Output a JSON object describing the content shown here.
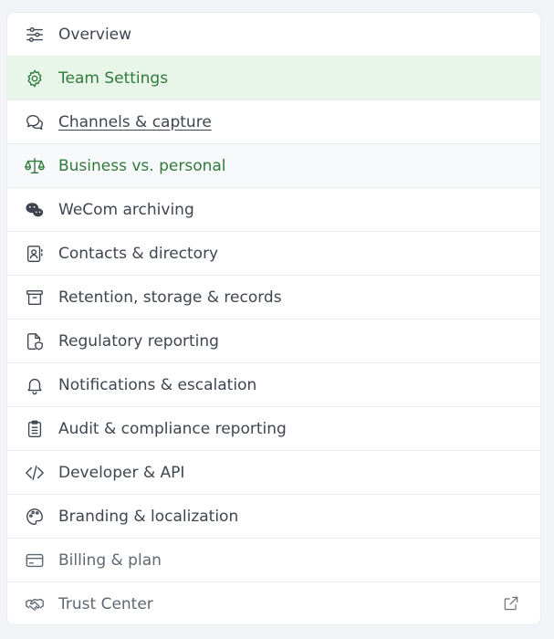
{
  "nav": {
    "items": [
      {
        "label": "Overview",
        "icon": "sliders-icon",
        "state": "normal"
      },
      {
        "label": "Team Settings",
        "icon": "gear-icon",
        "state": "active"
      },
      {
        "label": "Channels & capture",
        "icon": "chat-bubbles-icon",
        "state": "underlined"
      },
      {
        "label": "Business vs. personal",
        "icon": "scale-icon",
        "state": "hovered"
      },
      {
        "label": "WeCom archiving",
        "icon": "wechat-icon",
        "state": "normal"
      },
      {
        "label": "Contacts & directory",
        "icon": "contact-book-icon",
        "state": "normal"
      },
      {
        "label": "Retention, storage & records",
        "icon": "archive-box-icon",
        "state": "normal"
      },
      {
        "label": "Regulatory reporting",
        "icon": "file-shield-icon",
        "state": "normal"
      },
      {
        "label": "Notifications & escalation",
        "icon": "bell-icon",
        "state": "normal"
      },
      {
        "label": "Audit & compliance reporting",
        "icon": "clipboard-list-icon",
        "state": "normal"
      },
      {
        "label": "Developer & API",
        "icon": "code-icon",
        "state": "normal"
      },
      {
        "label": "Branding & localization",
        "icon": "palette-icon",
        "state": "normal"
      },
      {
        "label": "Billing & plan",
        "icon": "credit-card-icon",
        "state": "muted"
      },
      {
        "label": "Trust Center",
        "icon": "handshake-icon",
        "state": "muted",
        "external_icon": "external-link-icon"
      }
    ]
  },
  "colors": {
    "active_bg": "#e8f6e9",
    "active_text": "#2f7a3a",
    "text": "#3e4550",
    "divider": "#eceff1"
  }
}
